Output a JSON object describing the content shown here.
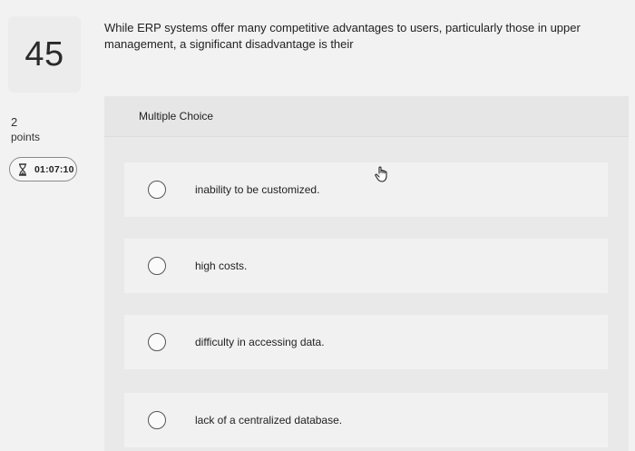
{
  "question": {
    "number": "45",
    "points_value": "2",
    "points_label": "points",
    "timer": "01:07:10",
    "text": "While ERP systems offer many competitive advantages to users, particularly those in upper management, a significant disadvantage is their"
  },
  "answer": {
    "type_label": "Multiple Choice",
    "options": [
      {
        "label": "inability to be customized."
      },
      {
        "label": "high costs."
      },
      {
        "label": "difficulty in accessing data."
      },
      {
        "label": "lack of a centralized database."
      }
    ]
  },
  "icons": {
    "timer": "hourglass-icon",
    "cursor": "hand-pointer-icon"
  }
}
